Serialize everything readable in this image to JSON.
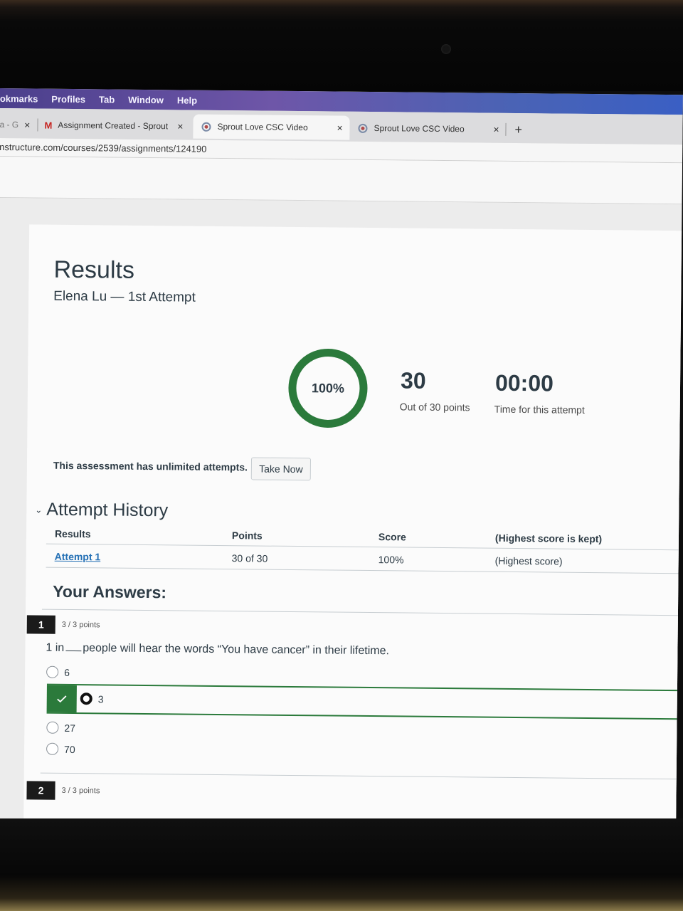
{
  "menubar": {
    "items": [
      "okmarks",
      "Profiles",
      "Tab",
      "Window",
      "Help"
    ]
  },
  "tabs": [
    {
      "title": "a - G",
      "close": "×"
    },
    {
      "title": "Assignment Created - Sprout L",
      "close": "×"
    },
    {
      "title": "Sprout Love CSC Video",
      "close": "×"
    },
    {
      "title": "Sprout Love CSC Video",
      "close": "×"
    }
  ],
  "new_tab": "+",
  "url": "nstructure.com/courses/2539/assignments/124190",
  "results": {
    "title": "Results",
    "subtitle": "Elena Lu — 1st Attempt",
    "percent_label": "100%",
    "percent_value": 1.0,
    "ring_color": "#2b7a3b",
    "score": "30",
    "score_caption": "Out of 30 points",
    "time": "00:00",
    "time_caption": "Time for this attempt"
  },
  "attempts": {
    "notice": "This assessment has unlimited attempts.",
    "take_now": "Take Now"
  },
  "history": {
    "toggle_icon": "chevron-down",
    "title": "Attempt History",
    "headers": [
      "Results",
      "Points",
      "Score",
      "(Highest score is kept)"
    ],
    "rows": [
      {
        "result": "Attempt 1",
        "points": "30 of 30",
        "score": "100%",
        "note": "(Highest score)"
      }
    ]
  },
  "answers": {
    "heading": "Your Answers:",
    "questions": [
      {
        "number": "1",
        "points": "3 / 3 points",
        "text_before": "1 in",
        "text_after": "people will hear the words “You have cancer” in their lifetime.",
        "options": [
          "6",
          "3",
          "27",
          "70"
        ],
        "selected": "3",
        "correct": "3"
      },
      {
        "number": "2",
        "points": "3 / 3 points"
      }
    ]
  }
}
